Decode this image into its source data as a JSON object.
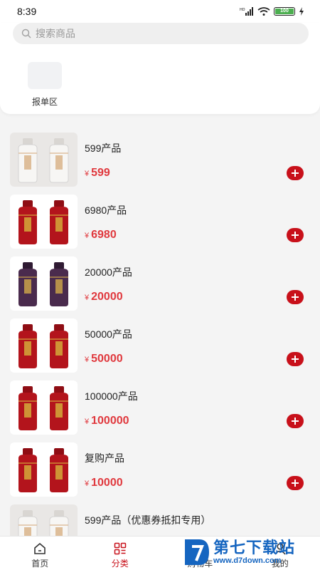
{
  "status_bar": {
    "time": "8:39",
    "hd_label": "HD",
    "battery_level": "100"
  },
  "search": {
    "placeholder": "搜索商品"
  },
  "categories": [
    {
      "label": "报单区"
    }
  ],
  "products": [
    {
      "name": "599产品",
      "currency": "¥",
      "price": "599",
      "style": "white"
    },
    {
      "name": "6980产品",
      "currency": "¥",
      "price": "6980",
      "style": "red"
    },
    {
      "name": "20000产品",
      "currency": "¥",
      "price": "20000",
      "style": "purple"
    },
    {
      "name": "50000产品",
      "currency": "¥",
      "price": "50000",
      "style": "red"
    },
    {
      "name": "100000产品",
      "currency": "¥",
      "price": "100000",
      "style": "red"
    },
    {
      "name": "复购产品",
      "currency": "¥",
      "price": "10000",
      "style": "red"
    },
    {
      "name": "599产品（优惠券抵扣专用）",
      "currency": "¥",
      "price": "",
      "style": "white"
    }
  ],
  "bottom_nav": [
    {
      "label": "首页",
      "icon": "home-icon",
      "active": false
    },
    {
      "label": "分类",
      "icon": "category-icon",
      "active": true
    },
    {
      "label": "购物车",
      "icon": "cart-icon",
      "active": false
    },
    {
      "label": "我的",
      "icon": "user-icon",
      "active": false
    }
  ],
  "watermark": {
    "title": "第七下载站",
    "url": "www.d7down.com"
  },
  "colors": {
    "accent": "#c8101a",
    "price": "#e0393e",
    "wine_red": "#b3141c",
    "wine_purple": "#4a2b4d",
    "watermark": "#1565c0"
  }
}
